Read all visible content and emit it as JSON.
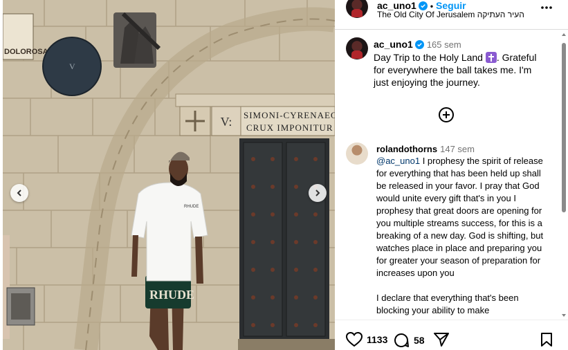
{
  "header": {
    "username": "ac_uno1",
    "follow_label": "Seguir",
    "location": "The Old City Of Jerusalem העיר העתיקה"
  },
  "caption": {
    "username": "ac_uno1",
    "time": "165 sem",
    "text_before": "Day Trip to the Holy Land ",
    "text_after": ". Grateful for everywhere the ball takes me. I'm just enjoying the journey."
  },
  "comment": {
    "username": "rolandothorns",
    "time": "147 sem",
    "mention": "@ac_uno1",
    "text": " I prophesy the spirit of release for everything that has been held up shall be released in your favor. I pray that God would unite every gift that's in you I prophesy that great doors are opening for you multiple streams success, for this is a breaking of a new day. God is shifting, but watches place in place and preparing you for greater your season of preparation for increases upon you",
    "text2": "I declare that everything that's been blocking your ability to make"
  },
  "photo": {
    "sign_line1": "SIMONI-CYRENAEO",
    "sign_line2": "CRUX IMPONITUR",
    "sign_numeral": "V:",
    "left_sign": "DOLOROSA",
    "medallion": "V",
    "shorts_text": "RHUDE",
    "shirt_text": "RHUDE"
  },
  "actions": {
    "likes": "1133",
    "comments": "58"
  },
  "colors": {
    "accent": "#0095f6",
    "verified": "#0095f6",
    "emoji": "#8a5bd1"
  },
  "icons": [
    "verified-badge-icon",
    "more-options-icon",
    "add-comment-icon",
    "heart-icon",
    "comment-icon",
    "share-icon",
    "bookmark-icon",
    "chevron-left-icon",
    "chevron-right-icon",
    "latin-cross-emoji"
  ]
}
